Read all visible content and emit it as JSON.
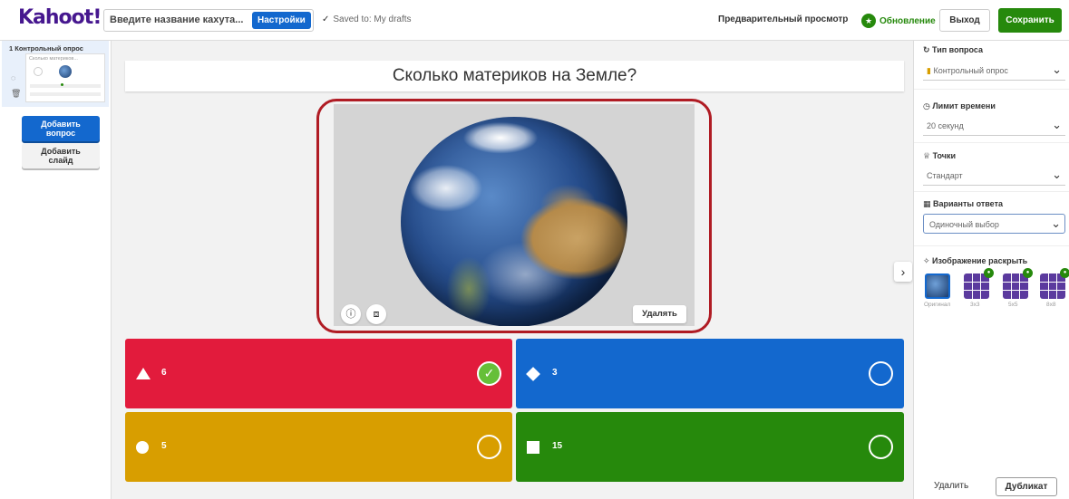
{
  "app": {
    "logo": "Kahoot",
    "logo_bang": "!"
  },
  "topbar": {
    "title_placeholder": "Введите название кахута...",
    "settings_label": "Настройки",
    "saved_label": "Saved to: My drafts",
    "preview_label": "Предварительный просмотр",
    "update_label": "Обновление",
    "exit_label": "Выход",
    "save_label": "Сохранить"
  },
  "sidebar": {
    "slide_label": "1  Контрольный опрос",
    "slide_thumb_title": "Сколько материков...",
    "add_question_line1": "Добавить",
    "add_question_line2": "вопрос",
    "add_slide_line1": "Добавить",
    "add_slide_line2": "слайд"
  },
  "editor": {
    "question": "Сколько материков на Земле?",
    "delete_media_label": "Удалять",
    "answers": [
      {
        "text": "6",
        "shape": "triangle",
        "correct": true,
        "color": "#e21b3c"
      },
      {
        "text": "3",
        "shape": "diamond",
        "correct": false,
        "color": "#1368ce"
      },
      {
        "text": "5",
        "shape": "circle",
        "correct": false,
        "color": "#d89e00"
      },
      {
        "text": "15",
        "shape": "square",
        "correct": false,
        "color": "#26890c"
      }
    ]
  },
  "right_panel": {
    "question_type_label": "Тип вопроса",
    "question_type_value": "Контрольный опрос",
    "time_limit_label": "Лимит времени",
    "time_limit_value": "20 секунд",
    "points_label": "Точки",
    "points_value": "Стандарт",
    "answer_options_label": "Варианты ответа",
    "answer_options_value": "Одиночный выбор",
    "image_reveal_label": "Изображение раскрыть",
    "reveal_options": [
      "Оригинал",
      "3x3",
      "5x5",
      "8x8"
    ],
    "delete_label": "Удалить",
    "duplicate_label": "Дубликат"
  },
  "colors": {
    "brand": "#46178f",
    "primary": "#1368ce",
    "success": "#26890c",
    "highlight_ring": "#b01c24"
  },
  "icons": [
    "check-icon",
    "star-icon",
    "chat-icon",
    "trash-icon",
    "info-icon",
    "crop-icon",
    "chevron-right-icon",
    "chevron-down-icon",
    "clock-icon",
    "trophy-icon",
    "grid-icon",
    "sparkle-icon",
    "lock-icon"
  ]
}
